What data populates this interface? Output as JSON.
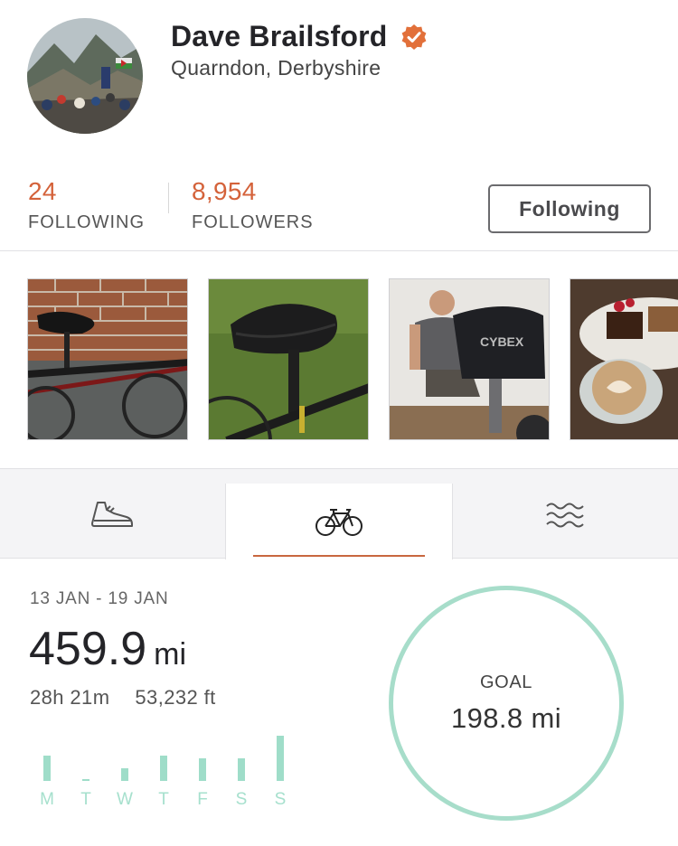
{
  "profile": {
    "name": "Dave Brailsford",
    "location": "Quarndon, Derbyshire",
    "verified_color": "#e2703a",
    "avatar_icon": "profile-photo-mountain-group"
  },
  "stats": {
    "following_count": "24",
    "following_label": "FOLLOWING",
    "followers_count": "8,954",
    "followers_label": "FOLLOWERS"
  },
  "follow_button": {
    "label": "Following"
  },
  "photos": [
    {
      "icon": "photo-bike-saddle-brick-wall"
    },
    {
      "icon": "photo-bike-saddle-grass"
    },
    {
      "icon": "photo-man-on-exercise-bike"
    },
    {
      "icon": "photo-cake-and-coffee"
    }
  ],
  "tabs": [
    {
      "icon": "running-shoe-icon",
      "active": false
    },
    {
      "icon": "bicycle-icon",
      "active": true
    },
    {
      "icon": "swim-waves-icon",
      "active": false
    }
  ],
  "summary": {
    "week_range": "13 JAN - 19 JAN",
    "distance_value": "459.9",
    "distance_unit": "mi",
    "time": "28h 21m",
    "elevation": "53,232 ft"
  },
  "daily_bars": [
    {
      "day": "M",
      "level": 0.57
    },
    {
      "day": "T",
      "level": 0.03
    },
    {
      "day": "W",
      "level": 0.29
    },
    {
      "day": "T",
      "level": 0.57
    },
    {
      "day": "F",
      "level": 0.49
    },
    {
      "day": "S",
      "level": 0.49
    },
    {
      "day": "S",
      "level": 1.0
    }
  ],
  "goal": {
    "label": "GOAL",
    "value": "198.8 mi",
    "ring_color": "#a7ddca"
  },
  "colors": {
    "accent_orange": "#d4623a",
    "bar_green": "#9fddc9"
  }
}
